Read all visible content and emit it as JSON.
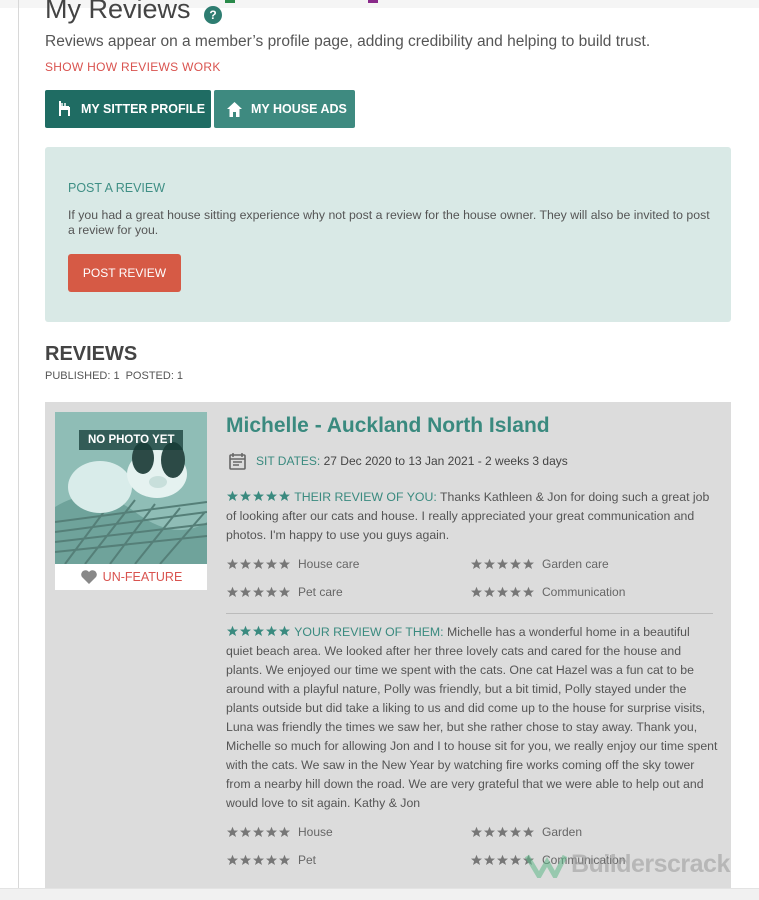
{
  "header": {
    "title": "My Reviews",
    "help_icon": "?",
    "intro": "Reviews appear on a member’s profile page, adding credibility and helping to build trust.",
    "show_how_link": "SHOW HOW REVIEWS WORK"
  },
  "tabs": [
    {
      "label": "MY SITTER PROFILE",
      "icon": "chair-icon"
    },
    {
      "label": "MY HOUSE ADS",
      "icon": "house-icon"
    }
  ],
  "post_review": {
    "heading": "POST A REVIEW",
    "text": "If you had a great house sitting experience why not post a review for the house owner. They will also be invited to post a review for you.",
    "button": "POST REVIEW"
  },
  "reviews": {
    "heading": "REVIEWS",
    "published_label": "PUBLISHED: 1",
    "posted_label": "POSTED: 1",
    "items": [
      {
        "photo_caption": "NO PHOTO YET",
        "unfeature_label": "UN-FEATURE",
        "member_name": "Michelle - Auckland North Island",
        "sit_dates_label": "SIT DATES:",
        "sit_dates_value": "27 Dec 2020 to 13 Jan 2021 - 2 weeks 3 days",
        "their_review_label": "THEIR REVIEW OF YOU:",
        "their_review_stars": 5,
        "their_review_text": "Thanks Kathleen & Jon for doing such a great job of looking after our cats and house. I really appreciated your great communication and photos. I'm happy to use you guys again.",
        "their_ratings": [
          {
            "label": "House care",
            "stars": 5
          },
          {
            "label": "Garden care",
            "stars": 5
          },
          {
            "label": "Pet care",
            "stars": 5
          },
          {
            "label": "Communication",
            "stars": 5
          }
        ],
        "your_review_label": "YOUR REVIEW OF THEM:",
        "your_review_stars": 5,
        "your_review_text": "Michelle has a wonderful home in a beautiful quiet beach area. We looked after her three lovely cats and cared for the house and plants. We enjoyed our time we spent with the cats. One cat Hazel was a fun cat to be around with a playful nature, Polly was friendly, but a bit timid, Polly stayed under the plants outside but did take a liking to us and did come up to the house for surprise visits, Luna was friendly the times we saw her, but she rather chose to stay away. Thank you, Michelle so much for allowing Jon and I to house sit for you, we really enjoy our time spent with the cats. We saw in the New Year by watching fire works coming off the sky tower from a nearby hill down the road. We are very grateful that we were able to help out and would love to sit again. Kathy & Jon",
        "your_ratings": [
          {
            "label": "House",
            "stars": 5
          },
          {
            "label": "Garden",
            "stars": 5
          },
          {
            "label": "Pet",
            "stars": 5
          },
          {
            "label": "Communication",
            "stars": 5
          }
        ]
      }
    ]
  },
  "watermark": "Builderscrack",
  "colors": {
    "teal_dark": "#1f6c63",
    "teal": "#3a8a7f",
    "coral": "#d65a45",
    "link_red": "#d9534f",
    "panel_bg": "#d9e9e6",
    "card_bg": "#dcdcdc"
  }
}
